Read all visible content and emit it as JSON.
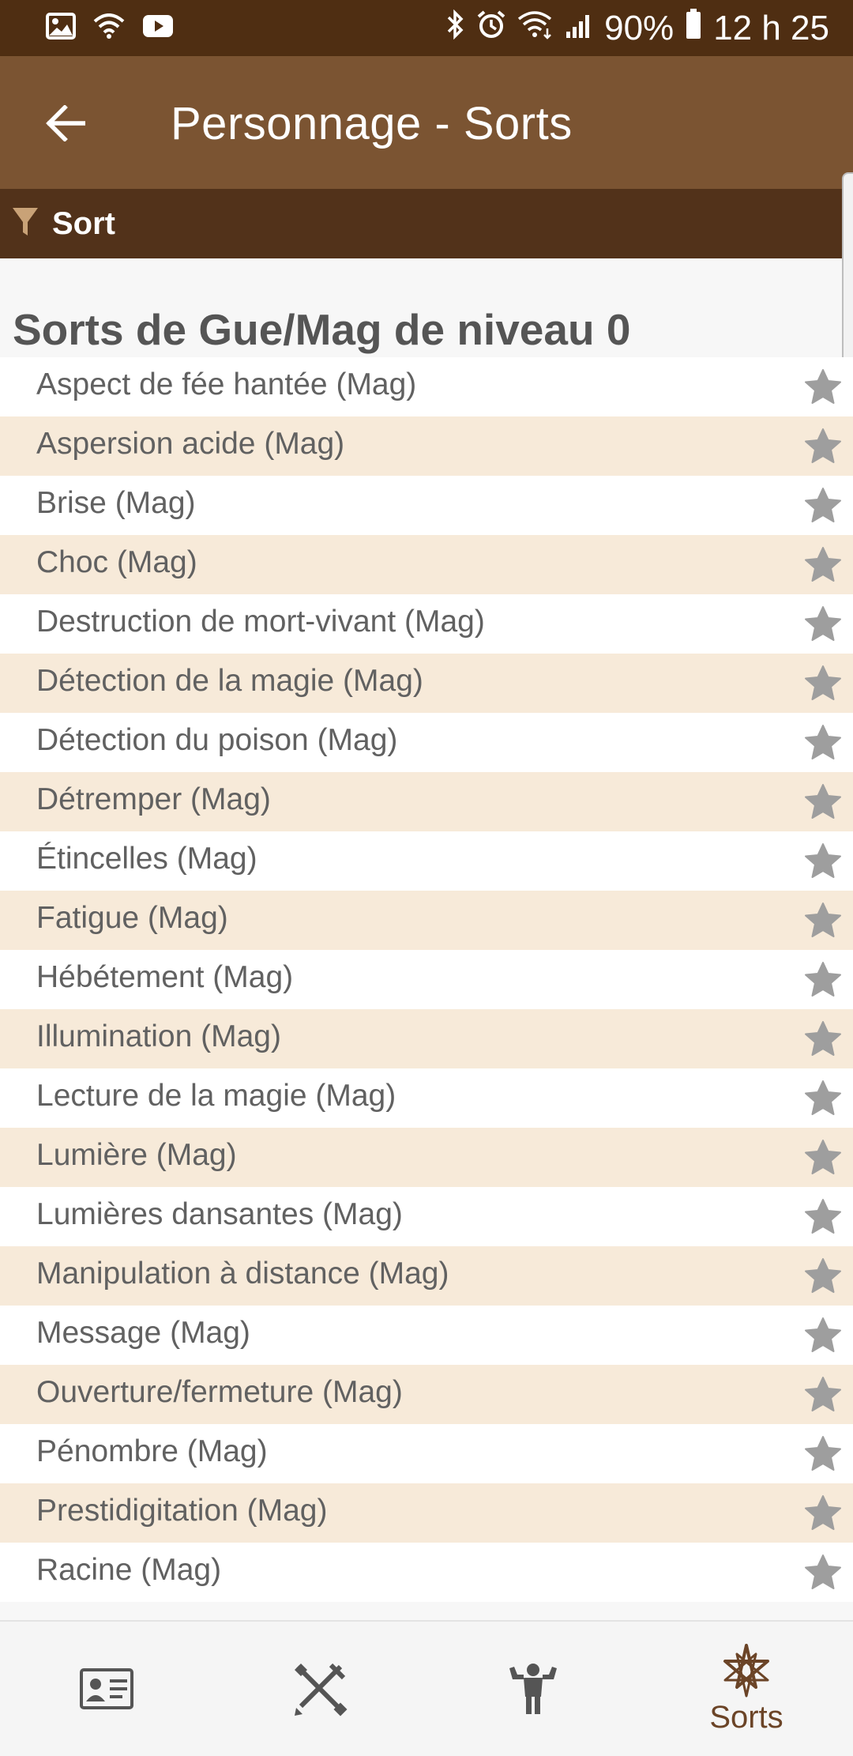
{
  "status_bar": {
    "battery": "90%",
    "time": "12 h 25",
    "left_icons": [
      "image-icon",
      "wifi-icon",
      "youtube-icon"
    ],
    "right_icons": [
      "bluetooth-icon",
      "alarm-icon",
      "wifi-signal-icon",
      "cell-signal-icon",
      "battery-icon"
    ]
  },
  "app_bar": {
    "title": "Personnage - Sorts",
    "back_icon": "arrow-left-icon"
  },
  "filter_bar": {
    "label": "Sort",
    "icon": "filter-icon"
  },
  "section": {
    "title": "Sorts de Gue/Mag de niveau 0"
  },
  "spells": [
    {
      "label": "Aspect de fée hantée (Mag)"
    },
    {
      "label": "Aspersion acide (Mag)"
    },
    {
      "label": "Brise (Mag)"
    },
    {
      "label": "Choc (Mag)"
    },
    {
      "label": "Destruction de mort-vivant (Mag)"
    },
    {
      "label": "Détection de la magie (Mag)"
    },
    {
      "label": "Détection du poison (Mag)"
    },
    {
      "label": "Détremper (Mag)"
    },
    {
      "label": "Étincelles (Mag)"
    },
    {
      "label": "Fatigue (Mag)"
    },
    {
      "label": "Hébétement (Mag)"
    },
    {
      "label": "Illumination (Mag)"
    },
    {
      "label": "Lecture de la magie (Mag)"
    },
    {
      "label": "Lumière (Mag)"
    },
    {
      "label": "Lumières dansantes (Mag)"
    },
    {
      "label": "Manipulation à distance (Mag)"
    },
    {
      "label": "Message (Mag)"
    },
    {
      "label": "Ouverture/fermeture (Mag)"
    },
    {
      "label": "Pénombre (Mag)"
    },
    {
      "label": "Prestidigitation (Mag)"
    },
    {
      "label": "Racine (Mag)"
    }
  ],
  "bottom_nav": {
    "items": [
      {
        "icon": "id-card-icon",
        "label": ""
      },
      {
        "icon": "crossed-weapons-icon",
        "label": ""
      },
      {
        "icon": "strongman-icon",
        "label": ""
      },
      {
        "icon": "heptagram-star-icon",
        "label": "Sorts",
        "active": true
      }
    ]
  },
  "colors": {
    "status_bar": "#4f2e12",
    "app_bar": "#7b5432",
    "filter_bar": "#52321a",
    "row_alt": "#f7ead9",
    "star": "#9e9e9e",
    "nav_active": "#6b4427"
  }
}
